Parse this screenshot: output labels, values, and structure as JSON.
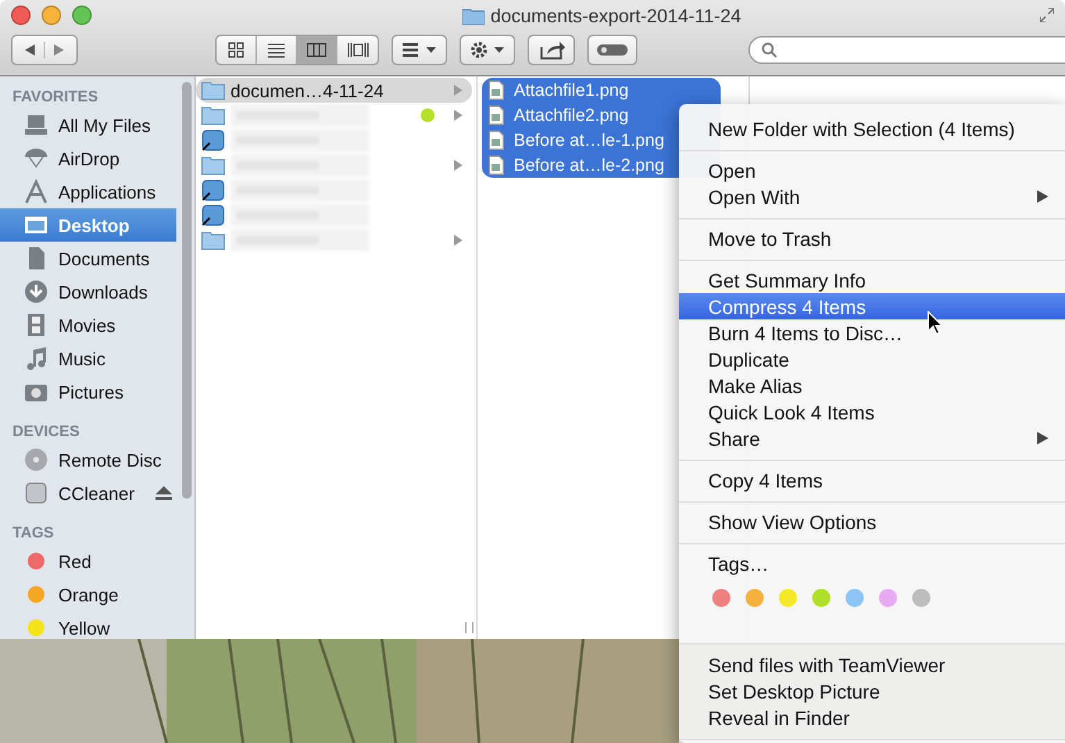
{
  "window": {
    "title": "documents-export-2014-11-24"
  },
  "toolbar": {
    "view_modes": [
      {
        "kind": "icons",
        "selected": false
      },
      {
        "kind": "list",
        "selected": false
      },
      {
        "kind": "columns",
        "selected": true
      },
      {
        "kind": "coverflow",
        "selected": false
      }
    ]
  },
  "sidebar": {
    "sections": [
      {
        "heading": "FAVORITES",
        "items": [
          {
            "label": "All My Files",
            "kind": "files",
            "selected": false
          },
          {
            "label": "AirDrop",
            "kind": "airdrop",
            "selected": false
          },
          {
            "label": "Applications",
            "kind": "apps",
            "selected": false
          },
          {
            "label": "Desktop",
            "kind": "desktop",
            "selected": true
          },
          {
            "label": "Documents",
            "kind": "documents",
            "selected": false
          },
          {
            "label": "Downloads",
            "kind": "downloads",
            "selected": false
          },
          {
            "label": "Movies",
            "kind": "movies",
            "selected": false
          },
          {
            "label": "Music",
            "kind": "music",
            "selected": false
          },
          {
            "label": "Pictures",
            "kind": "pictures",
            "selected": false
          }
        ]
      },
      {
        "heading": "DEVICES",
        "items": [
          {
            "label": "Remote Disc",
            "kind": "disc",
            "selected": false
          },
          {
            "label": "CCleaner",
            "kind": "drive",
            "selected": false,
            "ejectable": true
          }
        ]
      },
      {
        "heading": "TAGS",
        "items": [
          {
            "label": "Red",
            "kind": "tag",
            "color": "#ee6a6a",
            "selected": false
          },
          {
            "label": "Orange",
            "kind": "tag",
            "color": "#f5a623",
            "selected": false
          },
          {
            "label": "Yellow",
            "kind": "tag",
            "color": "#f2e418",
            "selected": false
          }
        ]
      }
    ]
  },
  "column_1": [
    {
      "name": "documen…4-11-24",
      "kind": "folder",
      "selected": true,
      "expandable": true
    },
    {
      "kind": "folder",
      "selected": false,
      "expandable": true,
      "color": "#b5e02a"
    },
    {
      "kind": "app",
      "selected": false,
      "expandable": false
    },
    {
      "kind": "folder",
      "selected": false,
      "expandable": true
    },
    {
      "kind": "app",
      "selected": false,
      "expandable": false
    },
    {
      "kind": "app",
      "selected": false,
      "expandable": false
    },
    {
      "kind": "folder",
      "selected": false,
      "expandable": true
    }
  ],
  "column_2": [
    {
      "name": "Attachfile1.png",
      "selected": true
    },
    {
      "name": "Attachfile2.png",
      "selected": true
    },
    {
      "name": "Before at…le-1.png",
      "selected": true
    },
    {
      "name": "Before at…le-2.png",
      "selected": true
    }
  ],
  "context_menu": {
    "sections": [
      {
        "kind": "items",
        "items": [
          {
            "label": "New Folder with Selection (4 Items)",
            "selected": false,
            "submenu": false
          }
        ]
      },
      {
        "kind": "items",
        "items": [
          {
            "label": "Open",
            "selected": false,
            "submenu": false
          },
          {
            "label": "Open With",
            "selected": false,
            "submenu": true
          }
        ]
      },
      {
        "kind": "items",
        "items": [
          {
            "label": "Move to Trash",
            "selected": false,
            "submenu": false
          }
        ]
      },
      {
        "kind": "items",
        "items": [
          {
            "label": "Get Summary Info",
            "selected": false,
            "submenu": false
          },
          {
            "label": "Compress 4 Items",
            "selected": true,
            "submenu": false
          },
          {
            "label": "Burn 4 Items to Disc…",
            "selected": false,
            "submenu": false
          },
          {
            "label": "Duplicate",
            "selected": false,
            "submenu": false
          },
          {
            "label": "Make Alias",
            "selected": false,
            "submenu": false
          },
          {
            "label": "Quick Look 4 Items",
            "selected": false,
            "submenu": false
          },
          {
            "label": "Share",
            "selected": false,
            "submenu": true
          }
        ]
      },
      {
        "kind": "items",
        "items": [
          {
            "label": "Copy 4 Items",
            "selected": false,
            "submenu": false
          }
        ]
      },
      {
        "kind": "items",
        "items": [
          {
            "label": "Show View Options",
            "selected": false,
            "submenu": false
          }
        ]
      },
      {
        "kind": "tags",
        "label": "Tags…",
        "colors": [
          {
            "color": "#ee8080"
          },
          {
            "color": "#f5b13c"
          },
          {
            "color": "#f5e82a"
          },
          {
            "color": "#aee02a"
          },
          {
            "color": "#8cc4f6"
          },
          {
            "color": "#e9aaf4"
          },
          {
            "color": "#bdbdbd"
          }
        ]
      },
      {
        "kind": "services",
        "items": [
          {
            "label": "Send files with TeamViewer",
            "selected": false,
            "submenu": false
          },
          {
            "label": "Set Desktop Picture",
            "selected": false,
            "submenu": false
          },
          {
            "label": "Reveal in Finder",
            "selected": false,
            "submenu": false
          }
        ]
      }
    ]
  }
}
